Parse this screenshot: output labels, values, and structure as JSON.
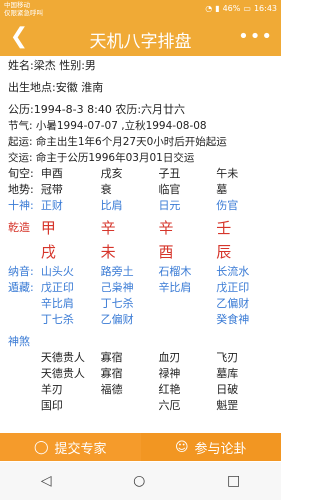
{
  "status": {
    "carrier1": "中国移动",
    "carrier2": "仅限紧急呼叫",
    "battery": "46%",
    "time": "16:43"
  },
  "app": {
    "title": "天机八字排盘",
    "back_icon": "chevron-left-icon",
    "more_icon": "more-dots-icon"
  },
  "info": {
    "name_line": "姓名:梁杰  性别:男",
    "birthplace": "出生地点:安徽  淮南",
    "gongli": "公历:1994-8-3 8:40 农历:六月廿六",
    "jieqi": "节气: 小暑1994-07-07 ,立秋1994-08-08",
    "qiyun": "起运: 命主出生1年6个月27天0小时后开始起运",
    "jiaoyun": "交运: 命主于公历1996年03月01日交运"
  },
  "table": {
    "xunkong": {
      "label": "旬空:",
      "cols": [
        "申酉",
        "戌亥",
        "子丑",
        "午未"
      ]
    },
    "dishi": {
      "label": "地势:",
      "cols": [
        "冠带",
        "衰",
        "临官",
        "墓"
      ]
    },
    "shishen": {
      "label": "十神:",
      "cols": [
        "正财",
        "比肩",
        "日元",
        "伤官"
      ]
    },
    "qianzao": {
      "label": "乾造",
      "gan": [
        "甲",
        "辛",
        "辛",
        "壬"
      ],
      "zhi": [
        "戌",
        "未",
        "酉",
        "辰"
      ]
    },
    "nayin": {
      "label": "纳音:",
      "cols": [
        "山头火",
        "路旁土",
        "石榴木",
        "长流水"
      ]
    },
    "canggan": {
      "label": "遁藏:",
      "rows": [
        [
          "戊正印",
          "己枭神",
          "辛比肩",
          "戊正印"
        ],
        [
          "辛比肩",
          "丁七杀",
          "",
          "乙偏财"
        ],
        [
          "丁七杀",
          "乙偏财",
          "",
          "癸食神"
        ]
      ]
    },
    "shensha": {
      "label": "神煞",
      "rows": [
        [
          "天德贵人",
          "寡宿",
          "血刃",
          "飞刃"
        ],
        [
          "天德贵人",
          "寡宿",
          "禄神",
          "墓库"
        ],
        [
          "羊刃",
          "福德",
          "红艳",
          "日破"
        ],
        [
          "国印",
          "",
          "六厄",
          "魁罡"
        ]
      ]
    }
  },
  "bottom": {
    "submit_label": "提交专家",
    "discuss_label": "参与论卦"
  }
}
